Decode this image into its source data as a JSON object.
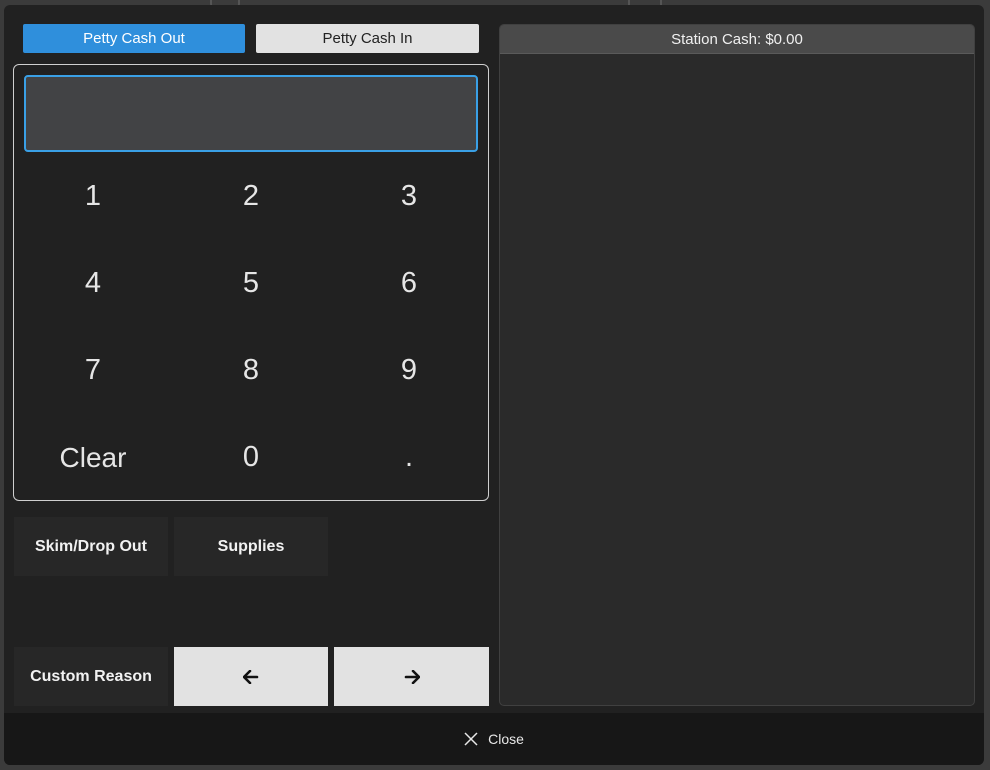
{
  "tabs": {
    "petty_cash_out": "Petty Cash Out",
    "petty_cash_in": "Petty Cash In"
  },
  "amount": {
    "value": "",
    "placeholder": ""
  },
  "keypad": {
    "k1": "1",
    "k2": "2",
    "k3": "3",
    "k4": "4",
    "k5": "5",
    "k6": "6",
    "k7": "7",
    "k8": "8",
    "k9": "9",
    "clear": "Clear",
    "k0": "0",
    "dot": "."
  },
  "reasons": {
    "skim": "Skim/Drop Out",
    "supplies": "Supplies",
    "custom": "Custom Reason"
  },
  "nav": {
    "prev_icon": "arrow-left-icon",
    "next_icon": "arrow-right-icon",
    "prev_glyph": "🡐",
    "next_glyph": "🡒"
  },
  "station": {
    "label": "Station Cash: $0.00"
  },
  "footer": {
    "close_label": "Close",
    "close_icon": "close-x-icon"
  },
  "colors": {
    "accent": "#2f8fdc",
    "input_border": "#3aa0e6",
    "modal_bg": "#212121"
  }
}
